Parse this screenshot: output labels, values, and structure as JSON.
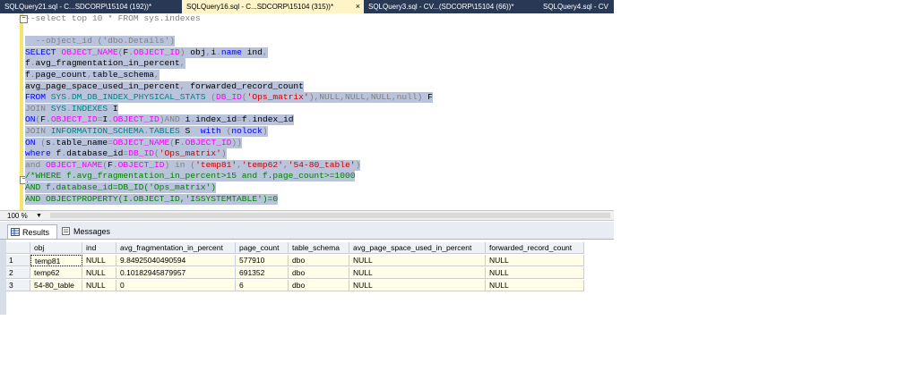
{
  "tabs": [
    {
      "label": "SQLQuery21.sql - C...SDCORP\\15104 (192))*",
      "active": false
    },
    {
      "label": "SQLQuery16.sql - C...SDCORP\\15104 (315))*",
      "active": true
    },
    {
      "label": "SQLQuery3.sql - CV...(SDCORP\\15104 (66))*",
      "active": false
    },
    {
      "label": "SQLQuery4.sql - CV",
      "active": false
    }
  ],
  "tab_close_glyph": "×",
  "editor": {
    "collapse_glyph": "−",
    "lines": [
      [
        {
          "c": "g",
          "t": "--select top 10 * FROM sys.indexes"
        }
      ],
      [],
      [
        {
          "c": "g",
          "t": "  --object_id ('dbo.Details')"
        }
      ],
      [
        {
          "c": "k",
          "t": "SELECT "
        },
        {
          "c": "f",
          "t": "OBJECT_NAME"
        },
        {
          "c": "g",
          "t": "("
        },
        {
          "c": "d",
          "t": "F"
        },
        {
          "c": "g",
          "t": "."
        },
        {
          "c": "f",
          "t": "OBJECT_ID"
        },
        {
          "c": "g",
          "t": ")"
        },
        {
          "c": "d",
          "t": " obj"
        },
        {
          "c": "g",
          "t": ","
        },
        {
          "c": "d",
          "t": "i"
        },
        {
          "c": "g",
          "t": "."
        },
        {
          "c": "k",
          "t": "name"
        },
        {
          "c": "d",
          "t": " ind"
        },
        {
          "c": "g",
          "t": ","
        }
      ],
      [
        {
          "c": "d",
          "t": "f"
        },
        {
          "c": "g",
          "t": "."
        },
        {
          "c": "d",
          "t": "avg_fragmentation_in_percent"
        },
        {
          "c": "g",
          "t": ","
        }
      ],
      [
        {
          "c": "d",
          "t": "f"
        },
        {
          "c": "g",
          "t": "."
        },
        {
          "c": "d",
          "t": "page_count"
        },
        {
          "c": "g",
          "t": ","
        },
        {
          "c": "d",
          "t": "table_schema"
        },
        {
          "c": "g",
          "t": ","
        }
      ],
      [
        {
          "c": "d",
          "t": "avg_page_space_used_in_percent"
        },
        {
          "c": "g",
          "t": ", "
        },
        {
          "c": "d",
          "t": "forwarded_record_count"
        }
      ],
      [
        {
          "c": "k",
          "t": "FROM "
        },
        {
          "c": "t",
          "t": "SYS"
        },
        {
          "c": "g",
          "t": "."
        },
        {
          "c": "t",
          "t": "DM_DB_INDEX_PHYSICAL_STATS"
        },
        {
          "c": "g",
          "t": " ("
        },
        {
          "c": "f",
          "t": "DB_ID"
        },
        {
          "c": "g",
          "t": "("
        },
        {
          "c": "s",
          "t": "'Ops_matrix'"
        },
        {
          "c": "g",
          "t": "),"
        },
        {
          "c": "g",
          "t": "NULL"
        },
        {
          "c": "g",
          "t": ","
        },
        {
          "c": "g",
          "t": "NULL"
        },
        {
          "c": "g",
          "t": ","
        },
        {
          "c": "g",
          "t": "NULL"
        },
        {
          "c": "g",
          "t": ","
        },
        {
          "c": "g",
          "t": "null"
        },
        {
          "c": "g",
          "t": ") "
        },
        {
          "c": "d",
          "t": "F"
        }
      ],
      [
        {
          "c": "g",
          "t": "JOIN "
        },
        {
          "c": "t",
          "t": "SYS"
        },
        {
          "c": "g",
          "t": "."
        },
        {
          "c": "t",
          "t": "INDEXES"
        },
        {
          "c": "d",
          "t": " I"
        }
      ],
      [
        {
          "c": "k",
          "t": "ON"
        },
        {
          "c": "g",
          "t": "("
        },
        {
          "c": "d",
          "t": "F"
        },
        {
          "c": "g",
          "t": "."
        },
        {
          "c": "f",
          "t": "OBJECT_ID"
        },
        {
          "c": "g",
          "t": "="
        },
        {
          "c": "d",
          "t": "I"
        },
        {
          "c": "g",
          "t": "."
        },
        {
          "c": "f",
          "t": "OBJECT_ID"
        },
        {
          "c": "g",
          "t": ")"
        },
        {
          "c": "g",
          "t": "AND "
        },
        {
          "c": "d",
          "t": "i"
        },
        {
          "c": "g",
          "t": "."
        },
        {
          "c": "d",
          "t": "index_id"
        },
        {
          "c": "g",
          "t": "="
        },
        {
          "c": "d",
          "t": "f"
        },
        {
          "c": "g",
          "t": "."
        },
        {
          "c": "d",
          "t": "index_id"
        }
      ],
      [
        {
          "c": "g",
          "t": "JOIN "
        },
        {
          "c": "t",
          "t": "INFORMATION_SCHEMA"
        },
        {
          "c": "g",
          "t": "."
        },
        {
          "c": "t",
          "t": "TABLES"
        },
        {
          "c": "d",
          "t": " S "
        },
        {
          "c": "k",
          "t": " with "
        },
        {
          "c": "g",
          "t": "("
        },
        {
          "c": "k",
          "t": "nolock"
        },
        {
          "c": "g",
          "t": ")"
        }
      ],
      [
        {
          "c": "k",
          "t": "ON "
        },
        {
          "c": "g",
          "t": "("
        },
        {
          "c": "d",
          "t": "s"
        },
        {
          "c": "g",
          "t": "."
        },
        {
          "c": "d",
          "t": "table_name"
        },
        {
          "c": "g",
          "t": "="
        },
        {
          "c": "f",
          "t": "OBJECT_NAME"
        },
        {
          "c": "g",
          "t": "("
        },
        {
          "c": "d",
          "t": "F"
        },
        {
          "c": "g",
          "t": "."
        },
        {
          "c": "f",
          "t": "OBJECT_ID"
        },
        {
          "c": "g",
          "t": "))"
        }
      ],
      [
        {
          "c": "k",
          "t": "where "
        },
        {
          "c": "d",
          "t": "f"
        },
        {
          "c": "g",
          "t": "."
        },
        {
          "c": "d",
          "t": "database_id"
        },
        {
          "c": "g",
          "t": "="
        },
        {
          "c": "f",
          "t": "DB_ID"
        },
        {
          "c": "g",
          "t": "("
        },
        {
          "c": "s",
          "t": "'Ops_matrix'"
        },
        {
          "c": "g",
          "t": ")"
        }
      ],
      [
        {
          "c": "g",
          "t": "and "
        },
        {
          "c": "f",
          "t": "OBJECT_NAME"
        },
        {
          "c": "g",
          "t": "("
        },
        {
          "c": "d",
          "t": "F"
        },
        {
          "c": "g",
          "t": "."
        },
        {
          "c": "f",
          "t": "OBJECT_ID"
        },
        {
          "c": "g",
          "t": ") "
        },
        {
          "c": "g",
          "t": "in "
        },
        {
          "c": "g",
          "t": "("
        },
        {
          "c": "s",
          "t": "'temp81'"
        },
        {
          "c": "g",
          "t": ","
        },
        {
          "c": "s",
          "t": "'temp62'"
        },
        {
          "c": "g",
          "t": ","
        },
        {
          "c": "s",
          "t": "'54-80_table'"
        },
        {
          "c": "g",
          "t": ")"
        }
      ],
      [
        {
          "c": "c",
          "t": "/*WHERE f.avg_fragmentation_in_percent>15 and f.page_count>=1000"
        }
      ],
      [
        {
          "c": "c",
          "t": "AND f.database_id=DB_ID('Ops_matrix')"
        }
      ],
      [
        {
          "c": "c",
          "t": "AND OBJECTPROPERTY(I.OBJECT_ID,'ISSYSTEMTABLE')=0"
        }
      ]
    ]
  },
  "zoom": {
    "value": "100 %",
    "arrow": "▼"
  },
  "result_tabs": [
    {
      "label": "Results",
      "icon": "grid-icon",
      "active": true
    },
    {
      "label": "Messages",
      "icon": "messages-icon",
      "active": false
    }
  ],
  "grid": {
    "columns": [
      "obj",
      "ind",
      "avg_fragmentation_in_percent",
      "page_count",
      "table_schema",
      "avg_page_space_used_in_percent",
      "forwarded_record_count"
    ],
    "rows": [
      {
        "num": "1",
        "cells": [
          "temp81",
          "NULL",
          "9.84925040490594",
          "577910",
          "dbo",
          "NULL",
          "NULL"
        ]
      },
      {
        "num": "2",
        "cells": [
          "temp62",
          "NULL",
          "0.10182945879957",
          "691352",
          "dbo",
          "NULL",
          "NULL"
        ]
      },
      {
        "num": "3",
        "cells": [
          "54-80_table",
          "NULL",
          "0",
          "6",
          "dbo",
          "NULL",
          "NULL"
        ]
      }
    ]
  },
  "colors": {
    "tabstrip": "#293955",
    "active_tab": "#fff4c8",
    "selection": "#b9c3dc",
    "keyword": "#0000ff",
    "function": "#ff00ff",
    "string": "#cc0000",
    "comment": "#008000"
  }
}
